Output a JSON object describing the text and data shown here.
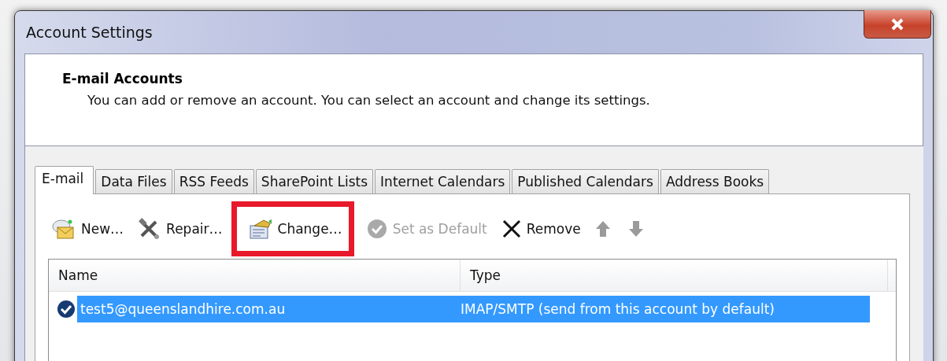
{
  "window": {
    "title": "Account Settings"
  },
  "header": {
    "title": "E-mail Accounts",
    "description": "You can add or remove an account. You can select an account and change its settings."
  },
  "tabs": [
    {
      "label": "E-mail",
      "selected": true
    },
    {
      "label": "Data Files",
      "selected": false
    },
    {
      "label": "RSS Feeds",
      "selected": false
    },
    {
      "label": "SharePoint Lists",
      "selected": false
    },
    {
      "label": "Internet Calendars",
      "selected": false
    },
    {
      "label": "Published Calendars",
      "selected": false
    },
    {
      "label": "Address Books",
      "selected": false
    }
  ],
  "toolbar": [
    {
      "kind": "new",
      "label": "New…",
      "disabled": false,
      "highlighted": false
    },
    {
      "kind": "repair",
      "label": "Repair…",
      "disabled": false,
      "highlighted": false
    },
    {
      "kind": "change",
      "label": "Change…",
      "disabled": false,
      "highlighted": true
    },
    {
      "kind": "default",
      "label": "Set as Default",
      "disabled": true,
      "highlighted": false
    },
    {
      "kind": "remove",
      "label": "Remove",
      "disabled": false,
      "highlighted": false
    },
    {
      "kind": "up",
      "disabled": true,
      "highlighted": false
    },
    {
      "kind": "down",
      "disabled": true,
      "highlighted": false
    }
  ],
  "table": {
    "columns": [
      "Name",
      "Type"
    ],
    "rows": [
      {
        "name": "test5@queenslandhire.com.au",
        "type": "IMAP/SMTP (send from this account by default)",
        "selected": true,
        "default": true
      }
    ]
  }
}
